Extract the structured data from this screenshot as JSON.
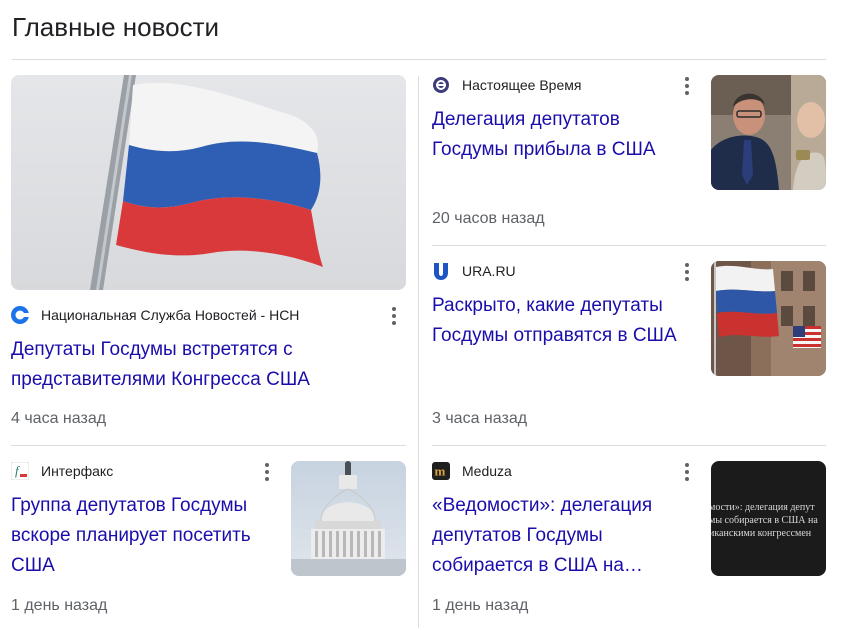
{
  "section_title": "Главные новости",
  "articles": [
    {
      "source": "Национальная Служба Новостей - НСН",
      "headline_lines": [
        "Депутаты Госдумы встретятся с",
        "представителями Конгресса США"
      ],
      "time": "4 часа назад",
      "favicon": "nsn-icon",
      "image": "russian-flag-photo"
    },
    {
      "source": "Настоящее Время",
      "headline_lines": [
        "Делегация депутатов",
        "Госдумы прибыла в США"
      ],
      "time": "20 часов назад",
      "favicon": "current-time-icon",
      "image": "deputies-talking-photo"
    },
    {
      "source": "URA.RU",
      "headline_lines": [
        "Раскрыто, какие депутаты",
        "Госдумы отправятся в США"
      ],
      "time": "3 часа назад",
      "favicon": "ura-icon",
      "image": "russia-us-flags-photo"
    },
    {
      "source": "Интерфакс",
      "headline_lines": [
        "Группа депутатов Госдумы",
        "вскоре планирует посетить",
        "США"
      ],
      "time": "1 день назад",
      "favicon": "interfax-icon",
      "image": "capitol-dome-photo"
    },
    {
      "source": "Meduza",
      "headline_lines": [
        "«Ведомости»: делегация",
        "депутатов Госдумы",
        "собирается в США на…"
      ],
      "time": "1 день назад",
      "favicon": "meduza-icon",
      "image": "text-snippet-photo"
    }
  ],
  "snippet_image_lines": [
    "мости»: делегация депут",
    "мы собирается в США на",
    "иканскими конгрессмен"
  ],
  "colors": {
    "link": "#1a0dab",
    "meta": "#5f6368",
    "divider": "#dadce0",
    "nsn": "#1a73e8",
    "ura": "#1d56c3",
    "current_time": "#3c3c7a"
  }
}
